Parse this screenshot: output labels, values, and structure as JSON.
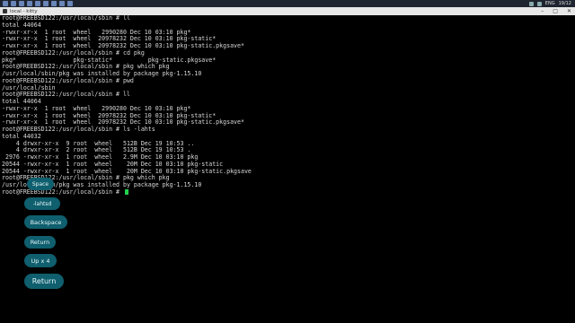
{
  "window": {
    "title": "local - kitty",
    "controls": [
      "–",
      "□",
      "✕"
    ]
  },
  "taskbar": {
    "lang": "ENG",
    "time": "19/12"
  },
  "terminal": {
    "lines": [
      "root@FREEBSD122:/usr/local/sbin # ll",
      "total 44064",
      "-rwxr-xr-x  1 root  wheel   2990280 Dec 10 03:10 pkg*",
      "-rwxr-xr-x  1 root  wheel  20978232 Dec 10 03:10 pkg-static*",
      "-rwxr-xr-x  1 root  wheel  20978232 Dec 10 03:10 pkg-static.pkgsave*",
      "root@FREEBSD122:/usr/local/sbin # cd pkg",
      "pkg*                pkg-static*          pkg-static.pkgsave*",
      "root@FREEBSD122:/usr/local/sbin # pkg which pkg",
      "/usr/local/sbin/pkg was installed by package pkg-1.15.10",
      "root@FREEBSD122:/usr/local/sbin # pwd",
      "/usr/local/sbin",
      "root@FREEBSD122:/usr/local/sbin # ll",
      "total 44064",
      "-rwxr-xr-x  1 root  wheel   2990280 Dec 10 03:10 pkg*",
      "-rwxr-xr-x  1 root  wheel  20978232 Dec 10 03:10 pkg-static*",
      "-rwxr-xr-x  1 root  wheel  20978232 Dec 10 03:10 pkg-static.pkgsave*",
      "root@FREEBSD122:/usr/local/sbin # ls -lahts",
      "total 44032",
      "    4 drwxr-xr-x  9 root  wheel   512B Dec 19 10:53 ..",
      "    4 drwxr-xr-x  2 root  wheel   512B Dec 19 10:53 .",
      " 2976 -rwxr-xr-x  1 root  wheel   2.9M Dec 10 03:10 pkg",
      "20544 -rwxr-xr-x  1 root  wheel    20M Dec 10 03:10 pkg-static",
      "20544 -rwxr-xr-x  1 root  wheel    20M Dec 10 03:10 pkg-static.pkgsave",
      "root@FREEBSD122:/usr/local/sbin # pkg which pkg",
      "/usr/local/sbin/pkg was installed by package pkg-1.15.10",
      "root@FREEBSD122:/usr/local/sbin # "
    ]
  },
  "keys": {
    "space": "Space",
    "lahtsd": "-lahtsd",
    "backspace": "Backspace",
    "return1": "Return",
    "up4": "Up x 4",
    "return2": "Return"
  },
  "colors": {
    "terminal_bg": "#000000",
    "text": "#d8d8d8",
    "cursor": "#22d24a",
    "key_bg": "#0f5f6e"
  }
}
